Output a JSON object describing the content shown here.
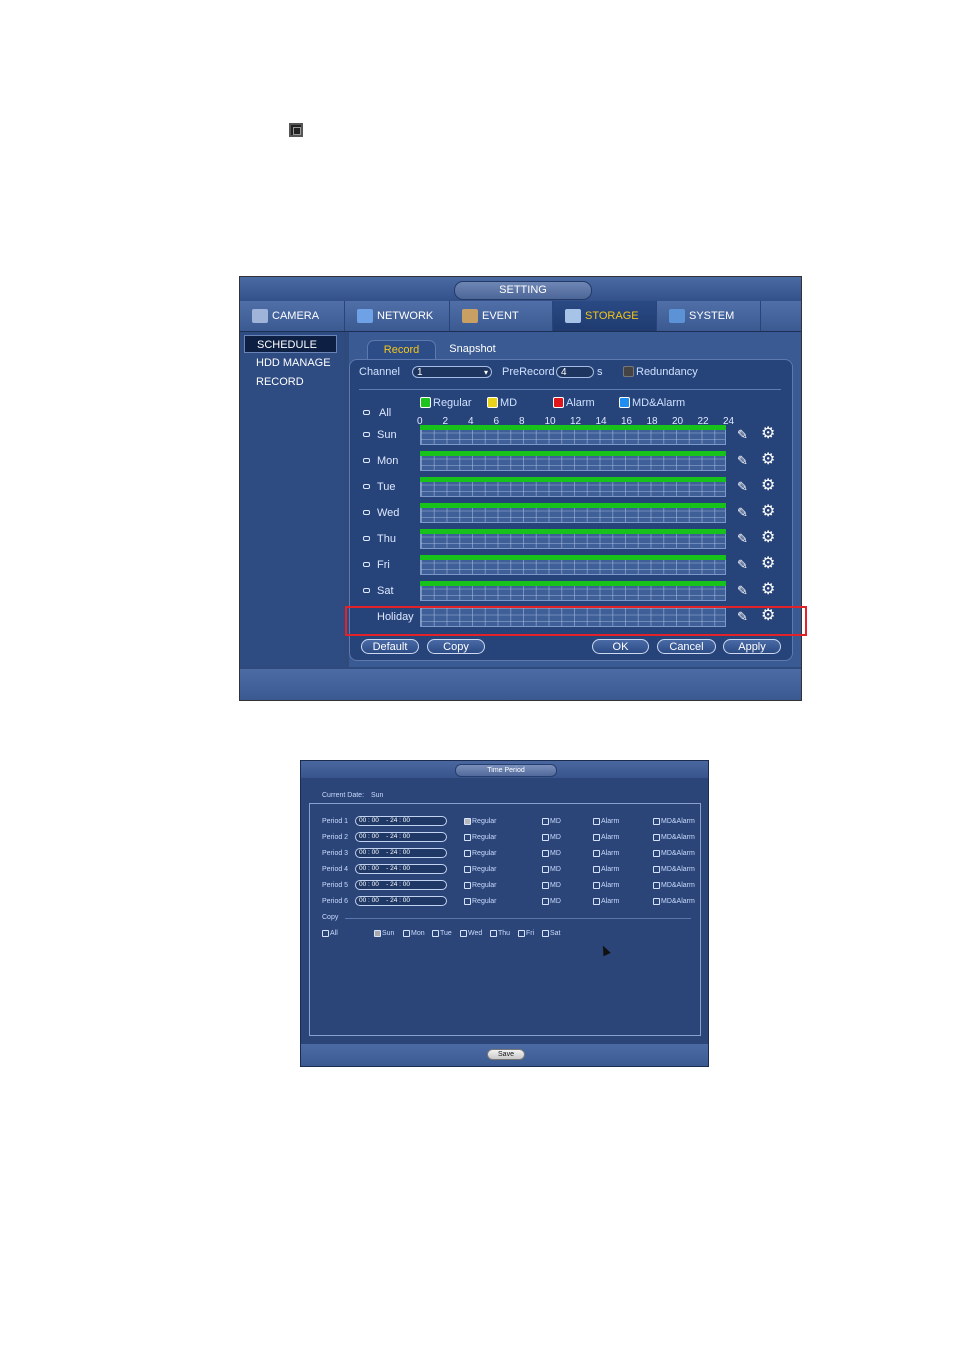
{
  "setting": {
    "title": "SETTING",
    "main_tabs": [
      {
        "label": "CAMERA",
        "icon": "camera-icon"
      },
      {
        "label": "NETWORK",
        "icon": "network-icon"
      },
      {
        "label": "EVENT",
        "icon": "event-icon"
      },
      {
        "label": "STORAGE",
        "icon": "storage-icon",
        "active": true
      },
      {
        "label": "SYSTEM",
        "icon": "system-icon"
      }
    ],
    "sidebar": [
      {
        "label": "SCHEDULE",
        "active": true
      },
      {
        "label": "HDD MANAGE"
      },
      {
        "label": "RECORD"
      }
    ],
    "sub_tabs": [
      {
        "label": "Record",
        "active": true
      },
      {
        "label": "Snapshot"
      }
    ],
    "channel": {
      "label": "Channel",
      "value": "1"
    },
    "prerecord": {
      "label": "PreRecord",
      "value": "4",
      "unit": "s"
    },
    "redundancy": {
      "label": "Redundancy"
    },
    "legend": [
      {
        "label": "Regular",
        "color": "#1fc41f"
      },
      {
        "label": "MD",
        "color": "#e8d21a"
      },
      {
        "label": "Alarm",
        "color": "#e0161b"
      },
      {
        "label": "MD&Alarm",
        "color": "#1f8ef0"
      }
    ],
    "all_label": "All",
    "hours": [
      "0",
      "2",
      "4",
      "6",
      "8",
      "10",
      "12",
      "14",
      "16",
      "18",
      "20",
      "22",
      "24"
    ],
    "days": [
      {
        "label": "Sun",
        "regular": true
      },
      {
        "label": "Mon",
        "regular": true
      },
      {
        "label": "Tue",
        "regular": true
      },
      {
        "label": "Wed",
        "regular": true
      },
      {
        "label": "Thu",
        "regular": true
      },
      {
        "label": "Fri",
        "regular": true
      },
      {
        "label": "Sat",
        "regular": true
      },
      {
        "label": "Holiday",
        "regular": false
      }
    ],
    "buttons": {
      "default": "Default",
      "copy": "Copy",
      "ok": "OK",
      "cancel": "Cancel",
      "apply": "Apply"
    }
  },
  "time_period": {
    "title": "Time Period",
    "current_date_label": "Current Date:",
    "current_date": "Sun",
    "periods": [
      {
        "label": "Period 1",
        "start_h": "00",
        "start_m": "00",
        "end_h": "24",
        "end_m": "00"
      },
      {
        "label": "Period 2",
        "start_h": "00",
        "start_m": "00",
        "end_h": "24",
        "end_m": "00"
      },
      {
        "label": "Period 3",
        "start_h": "00",
        "start_m": "00",
        "end_h": "24",
        "end_m": "00"
      },
      {
        "label": "Period 4",
        "start_h": "00",
        "start_m": "00",
        "end_h": "24",
        "end_m": "00"
      },
      {
        "label": "Period 5",
        "start_h": "00",
        "start_m": "00",
        "end_h": "24",
        "end_m": "00"
      },
      {
        "label": "Period 6",
        "start_h": "00",
        "start_m": "00",
        "end_h": "24",
        "end_m": "00"
      }
    ],
    "types": [
      "Regular",
      "MD",
      "Alarm",
      "MD&Alarm"
    ],
    "copy_label": "Copy",
    "copy_days": [
      "All",
      "Sun",
      "Mon",
      "Tue",
      "Wed",
      "Thu",
      "Fri",
      "Sat"
    ],
    "save_label": "Save"
  }
}
